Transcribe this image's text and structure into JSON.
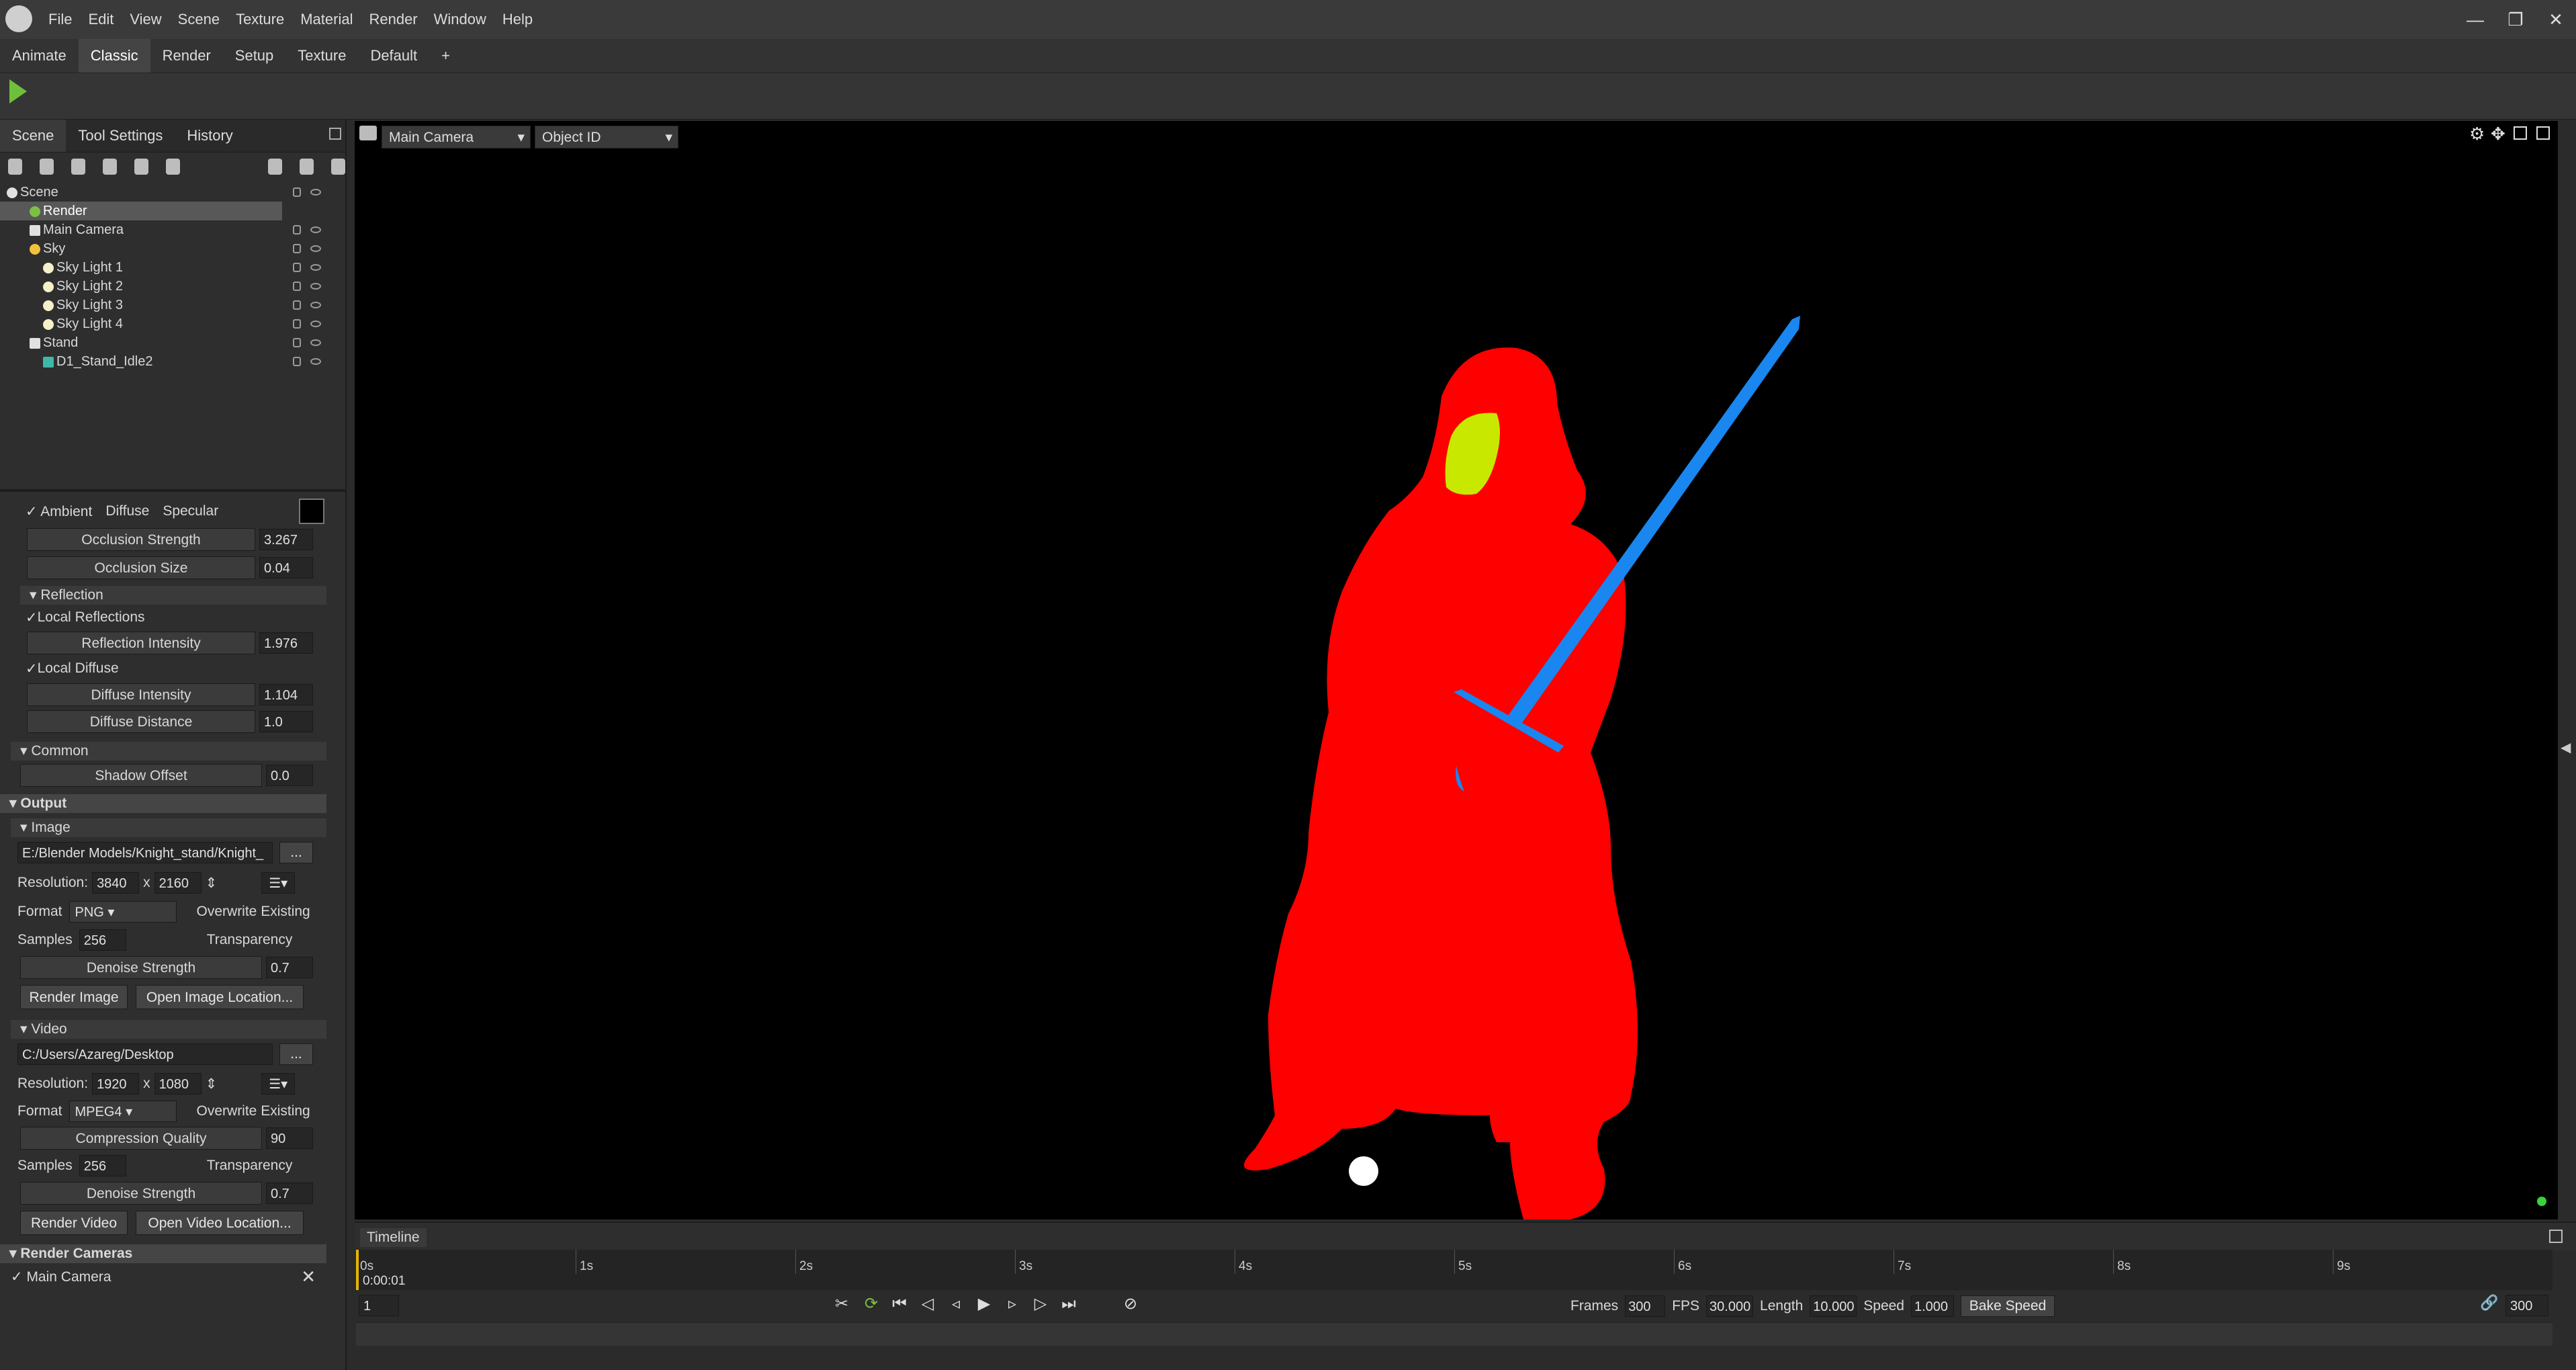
{
  "menubar": {
    "items": [
      "File",
      "Edit",
      "View",
      "Scene",
      "Texture",
      "Material",
      "Render",
      "Window",
      "Help"
    ]
  },
  "window": {
    "minimize": "—",
    "restore": "❐",
    "close": "✕"
  },
  "layouts": {
    "tabs": [
      "Animate",
      "Classic",
      "Render",
      "Setup",
      "Texture",
      "Default",
      "+"
    ],
    "active": "Classic"
  },
  "left_tabs": [
    "Scene",
    "Tool Settings",
    "History"
  ],
  "tree": [
    {
      "label": "Scene",
      "indent": 0
    },
    {
      "label": "Render",
      "indent": 1,
      "selected": true
    },
    {
      "label": "Main Camera",
      "indent": 1
    },
    {
      "label": "Sky",
      "indent": 1
    },
    {
      "label": "Sky Light 1",
      "indent": 2
    },
    {
      "label": "Sky Light 2",
      "indent": 2
    },
    {
      "label": "Sky Light 3",
      "indent": 2
    },
    {
      "label": "Sky Light 4",
      "indent": 2
    },
    {
      "label": "Stand",
      "indent": 1
    },
    {
      "label": "D1_Stand_Idle2",
      "indent": 2
    }
  ],
  "ambient": {
    "ambient": "Ambient",
    "diffuse": "Diffuse",
    "specular": "Specular",
    "occlusion_strength_label": "Occlusion Strength",
    "occlusion_strength": "3.267",
    "occlusion_size_label": "Occlusion Size",
    "occlusion_size": "0.04"
  },
  "reflection": {
    "title": "Reflection",
    "local_reflections": "Local Reflections",
    "intensity_label": "Reflection Intensity",
    "intensity": "1.976",
    "local_diffuse": "Local Diffuse",
    "diffuse_intensity_label": "Diffuse Intensity",
    "diffuse_intensity": "1.104",
    "diffuse_distance_label": "Diffuse Distance",
    "diffuse_distance": "1.0"
  },
  "common": {
    "title": "Common",
    "shadow_offset_label": "Shadow Offset",
    "shadow_offset": "0.0"
  },
  "output": {
    "title": "Output"
  },
  "image": {
    "title": "Image",
    "path": "E:/Blender Models/Knight_stand/Knight_",
    "browse": "...",
    "resolution_label": "Resolution:",
    "width": "3840",
    "x": "x",
    "height": "2160",
    "format_label": "Format",
    "format": "PNG",
    "overwrite": "Overwrite Existing",
    "samples_label": "Samples",
    "samples": "256",
    "transparency": "Transparency",
    "denoise_label": "Denoise Strength",
    "denoise": "0.7",
    "render_btn": "Render Image",
    "open_btn": "Open Image Location..."
  },
  "video": {
    "title": "Video",
    "path": "C:/Users/Azareg/Desktop",
    "browse": "...",
    "resolution_label": "Resolution:",
    "width": "1920",
    "x": "x",
    "height": "1080",
    "format_label": "Format",
    "format": "MPEG4",
    "overwrite": "Overwrite Existing",
    "quality_label": "Compression Quality",
    "quality": "90",
    "samples_label": "Samples",
    "samples": "256",
    "transparency": "Transparency",
    "denoise_label": "Denoise Strength",
    "denoise": "0.7",
    "render_btn": "Render Video",
    "open_btn": "Open Video Location..."
  },
  "render_cameras": {
    "title": "Render Cameras",
    "camera": "Main Camera",
    "remove": "✕"
  },
  "viewport": {
    "camera": "Main Camera",
    "mode": "Object ID",
    "colors": {
      "body": "#ff0000",
      "face": "#c8e800",
      "sword": "#1a86f0"
    }
  },
  "timeline": {
    "title": "Timeline",
    "time": "0:00:01",
    "ticks": [
      "0s",
      "1s",
      "2s",
      "3s",
      "4s",
      "5s",
      "6s",
      "7s",
      "8s",
      "9s"
    ],
    "frame": "1",
    "frames_label": "Frames",
    "frames": "300",
    "fps_label": "FPS",
    "fps": "30.000",
    "length_label": "Length",
    "length": "10.000",
    "speed_label": "Speed",
    "speed": "1.000",
    "bake_speed": "Bake Speed",
    "end_frame": "300"
  }
}
